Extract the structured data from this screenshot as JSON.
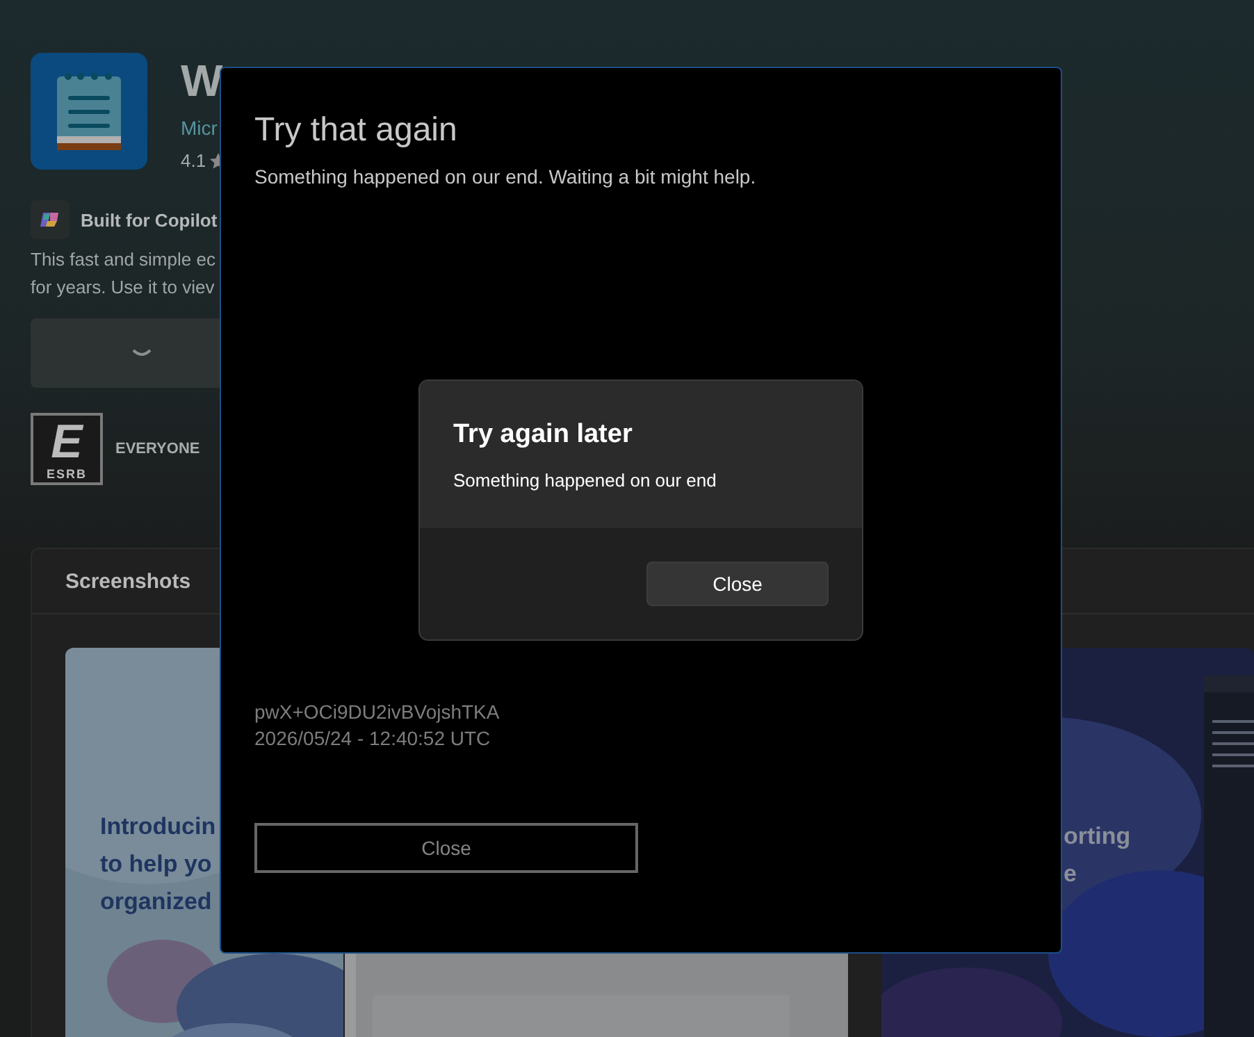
{
  "app": {
    "title": "W",
    "publisher": "Micr",
    "rating": "4.1",
    "copilot_badge": "Built for Copilot",
    "description": [
      "This fast and simple ec",
      "for years. Use it to viev"
    ],
    "install_button": {
      "busy": true
    },
    "esrb": {
      "letter": "E",
      "caption": "ESRB",
      "label": "EVERYONE"
    }
  },
  "screenshots": {
    "heading": "Screenshots",
    "items": [
      {
        "kind": "light",
        "lines": [
          "Introducin",
          "to help yo",
          "organized"
        ]
      },
      {
        "kind": "plain"
      },
      {
        "kind": "dark",
        "lines": [
          "orting",
          "e"
        ]
      }
    ]
  },
  "error_dialog": {
    "title": "Try that again",
    "message": "Something happened on our end. Waiting a bit might help.",
    "code": "pwX+OCi9DU2ivBVojshTKA",
    "timestamp": "2026/05/24 - 12:40:52 UTC",
    "button": "Close"
  },
  "alert": {
    "title": "Try again later",
    "message": "Something happened on our end",
    "button": "Close"
  }
}
